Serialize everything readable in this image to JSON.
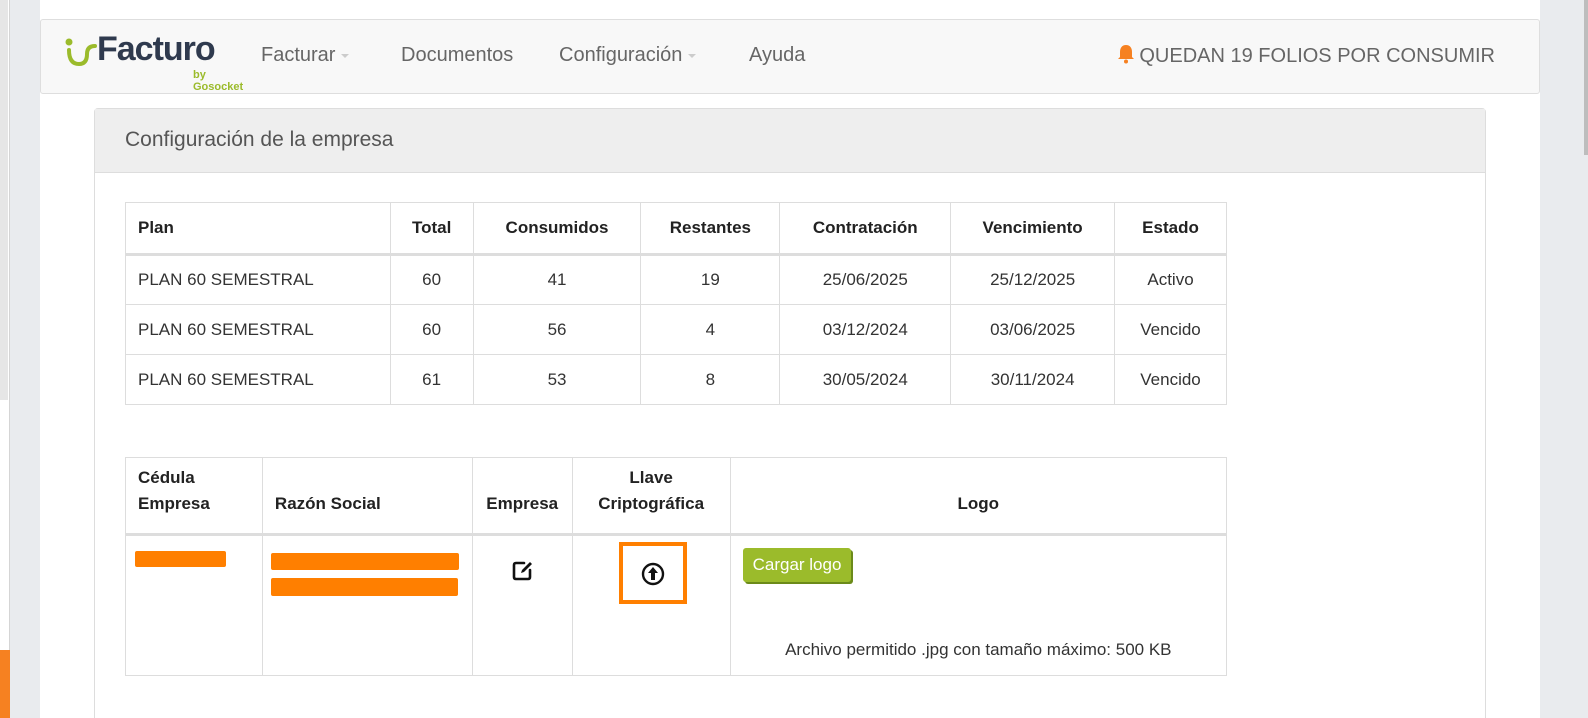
{
  "brand": {
    "name": "Facturo",
    "sub": "by Gosocket",
    "accent": "#9bbb2b",
    "highlight": "#ff7f00"
  },
  "nav": {
    "items": [
      {
        "label": "Facturar",
        "dropdown": true
      },
      {
        "label": "Documentos",
        "dropdown": false
      },
      {
        "label": "Configuración",
        "dropdown": true
      },
      {
        "label": "Ayuda",
        "dropdown": false
      }
    ],
    "folios": "QUEDAN 19 FOLIOS POR CONSUMIR",
    "folios_icon": "bell-icon"
  },
  "panel": {
    "title": "Configuración de la empresa"
  },
  "plans": {
    "headers": [
      "Plan",
      "Total",
      "Consumidos",
      "Restantes",
      "Contratación",
      "Vencimiento",
      "Estado"
    ],
    "rows": [
      [
        "PLAN 60 SEMESTRAL",
        "60",
        "41",
        "19",
        "25/06/2025",
        "25/12/2025",
        "Activo"
      ],
      [
        "PLAN 60 SEMESTRAL",
        "60",
        "56",
        "4",
        "03/12/2024",
        "03/06/2025",
        "Vencido"
      ],
      [
        "PLAN 60 SEMESTRAL",
        "61",
        "53",
        "8",
        "30/05/2024",
        "30/11/2024",
        "Vencido"
      ]
    ]
  },
  "company": {
    "headers": {
      "cedula_1": "Cédula",
      "cedula_2": "Empresa",
      "razon": "Razón Social",
      "empresa": "Empresa",
      "llave_1": "Llave",
      "llave_2": "Criptográfica",
      "logo": "Logo"
    },
    "edit_icon": "edit-icon",
    "upload_icon": "upload-arrow-icon",
    "logo_button": "Cargar logo",
    "logo_hint": "Archivo permitido .jpg con tamaño máximo: 500 KB"
  }
}
